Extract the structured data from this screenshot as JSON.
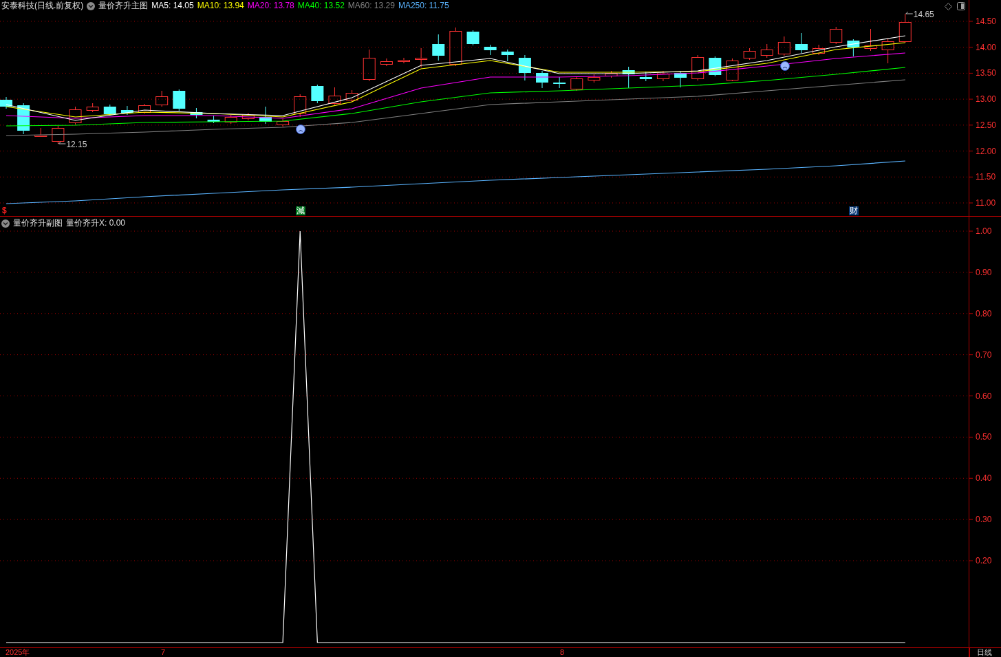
{
  "main_panel": {
    "stock": "安泰科技(日线.前复权)",
    "formula": "量价齐升主图",
    "indicators": [
      {
        "label": "MA5: 14.05",
        "color": "#ffffff"
      },
      {
        "label": "MA10: 13.94",
        "color": "#ffff00"
      },
      {
        "label": "MA20: 13.78",
        "color": "#ff00ff"
      },
      {
        "label": "MA40: 13.52",
        "color": "#00ff00"
      },
      {
        "label": "MA60: 13.29",
        "color": "#808080"
      },
      {
        "label": "MA250: 11.75",
        "color": "#5ab4ff"
      }
    ],
    "low_label": "12.15",
    "high_label": "14.65",
    "markers": [
      {
        "text": "$",
        "kind": "text",
        "color": "#ff2020"
      },
      {
        "text": "減",
        "kind": "badge",
        "color": "#007a20"
      },
      {
        "text": "财",
        "kind": "badge",
        "color": "#0a3a78"
      }
    ],
    "price_axis": [
      "14.50",
      "14.00",
      "13.50",
      "13.00",
      "12.50",
      "12.00",
      "11.50",
      "11.00"
    ]
  },
  "sub_panel": {
    "formula": "量价齐升副图",
    "reading": "量价齐升X: 0.00",
    "value_axis": [
      "1.00",
      "0.90",
      "0.80",
      "0.70",
      "0.60",
      "0.50",
      "0.40",
      "0.30",
      "0.20"
    ]
  },
  "time_axis": {
    "labels": [
      "2025年",
      "7",
      "8"
    ],
    "period": "日线"
  }
}
